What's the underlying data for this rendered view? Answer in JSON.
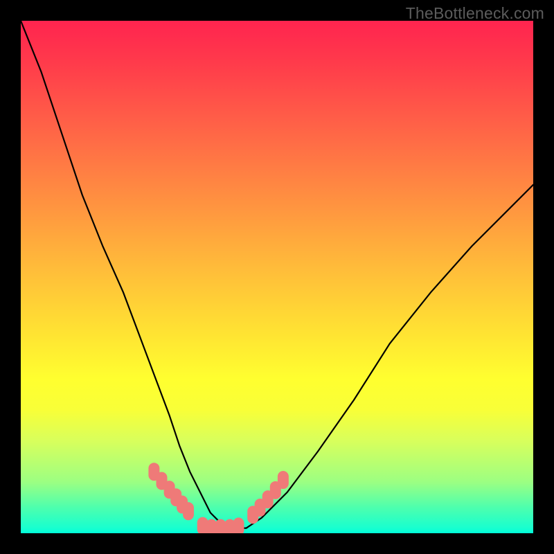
{
  "attribution": "TheBottleneck.com",
  "colors": {
    "frame": "#000000",
    "curve": "#000000",
    "marker": "#ef7a78",
    "gradient_top": "#ff244f",
    "gradient_mid": "#ffff2f",
    "gradient_bottom": "#00ffd9"
  },
  "chart_data": {
    "type": "line",
    "title": "",
    "xlabel": "",
    "ylabel": "",
    "xlim": [
      0,
      100
    ],
    "ylim": [
      0,
      100
    ],
    "grid": false,
    "legend": false,
    "curve": {
      "x": [
        0,
        4,
        8,
        12,
        16,
        20,
        23,
        26,
        29,
        31,
        33,
        35,
        37,
        39,
        41,
        44,
        47,
        52,
        58,
        65,
        72,
        80,
        88,
        95,
        100
      ],
      "y": [
        100,
        90,
        78,
        66,
        56,
        47,
        39,
        31,
        23,
        17,
        12,
        8,
        4,
        2,
        1,
        1,
        3,
        8,
        16,
        26,
        37,
        47,
        56,
        63,
        68
      ]
    },
    "markers": {
      "x": [
        26.0,
        27.5,
        29.0,
        30.3,
        31.5,
        32.7,
        35.5,
        37.2,
        39.0,
        40.8,
        42.5,
        45.3,
        46.7,
        48.2,
        49.7,
        51.2
      ],
      "y": [
        12.0,
        10.2,
        8.5,
        7.0,
        5.6,
        4.3,
        1.4,
        1.0,
        1.0,
        1.0,
        1.3,
        3.6,
        5.0,
        6.6,
        8.4,
        10.4
      ]
    }
  }
}
